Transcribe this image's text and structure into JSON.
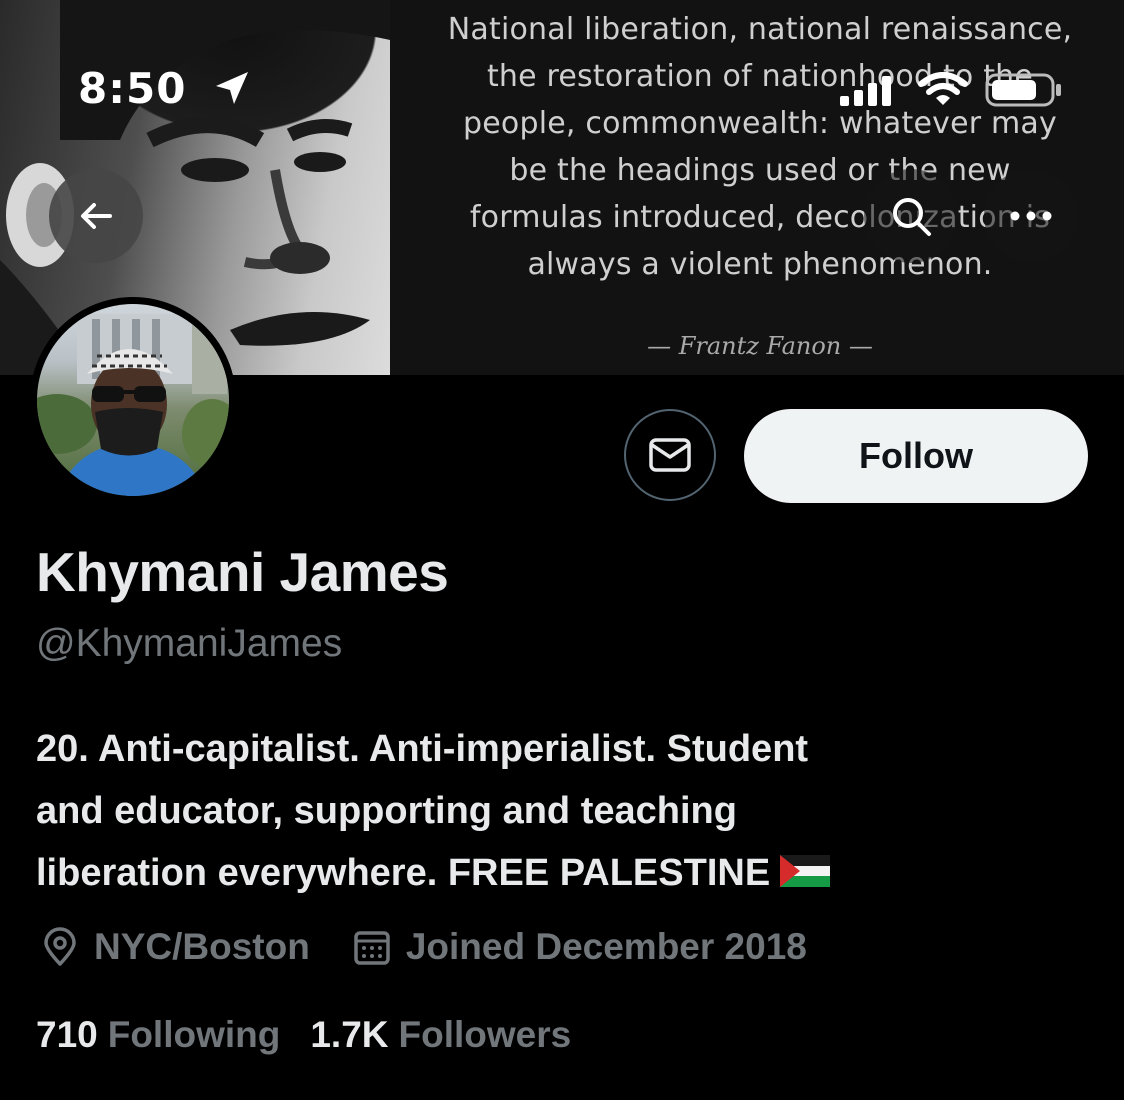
{
  "status_bar": {
    "time": "8:50",
    "icons": [
      "location-arrow-icon",
      "cellular-signal-icon",
      "wifi-icon",
      "battery-icon"
    ]
  },
  "banner": {
    "quote_lines": [
      "National liberation, national renaissance,",
      "the restoration of nationhood to the",
      "people, commonwealth: whatever may",
      "be the headings used or the new",
      "formulas introduced, decolonization is",
      "always a violent phenomenon."
    ],
    "quote_author": "— Frantz Fanon —"
  },
  "nav": {
    "icons": [
      "back-arrow-icon",
      "search-icon",
      "more-icon"
    ]
  },
  "actions": {
    "follow_label": "Follow",
    "message_icon": "mail-icon"
  },
  "profile": {
    "name": "Khymani James",
    "handle": "@KhymaniJames",
    "bio_lines": [
      "20. Anti-capitalist. Anti-imperialist. Student",
      "and educator, supporting and teaching",
      "liberation everywhere. FREE PALESTINE"
    ],
    "location": "NYC/Boston",
    "joined": "Joined December 2018",
    "following_count": "710",
    "following_label": "Following",
    "followers_count": "1.7K",
    "followers_label": "Followers"
  },
  "colors": {
    "background": "#000000",
    "primary_text": "#e7e9ea",
    "secondary_text": "#71767b",
    "follow_button": "#eff3f4"
  }
}
